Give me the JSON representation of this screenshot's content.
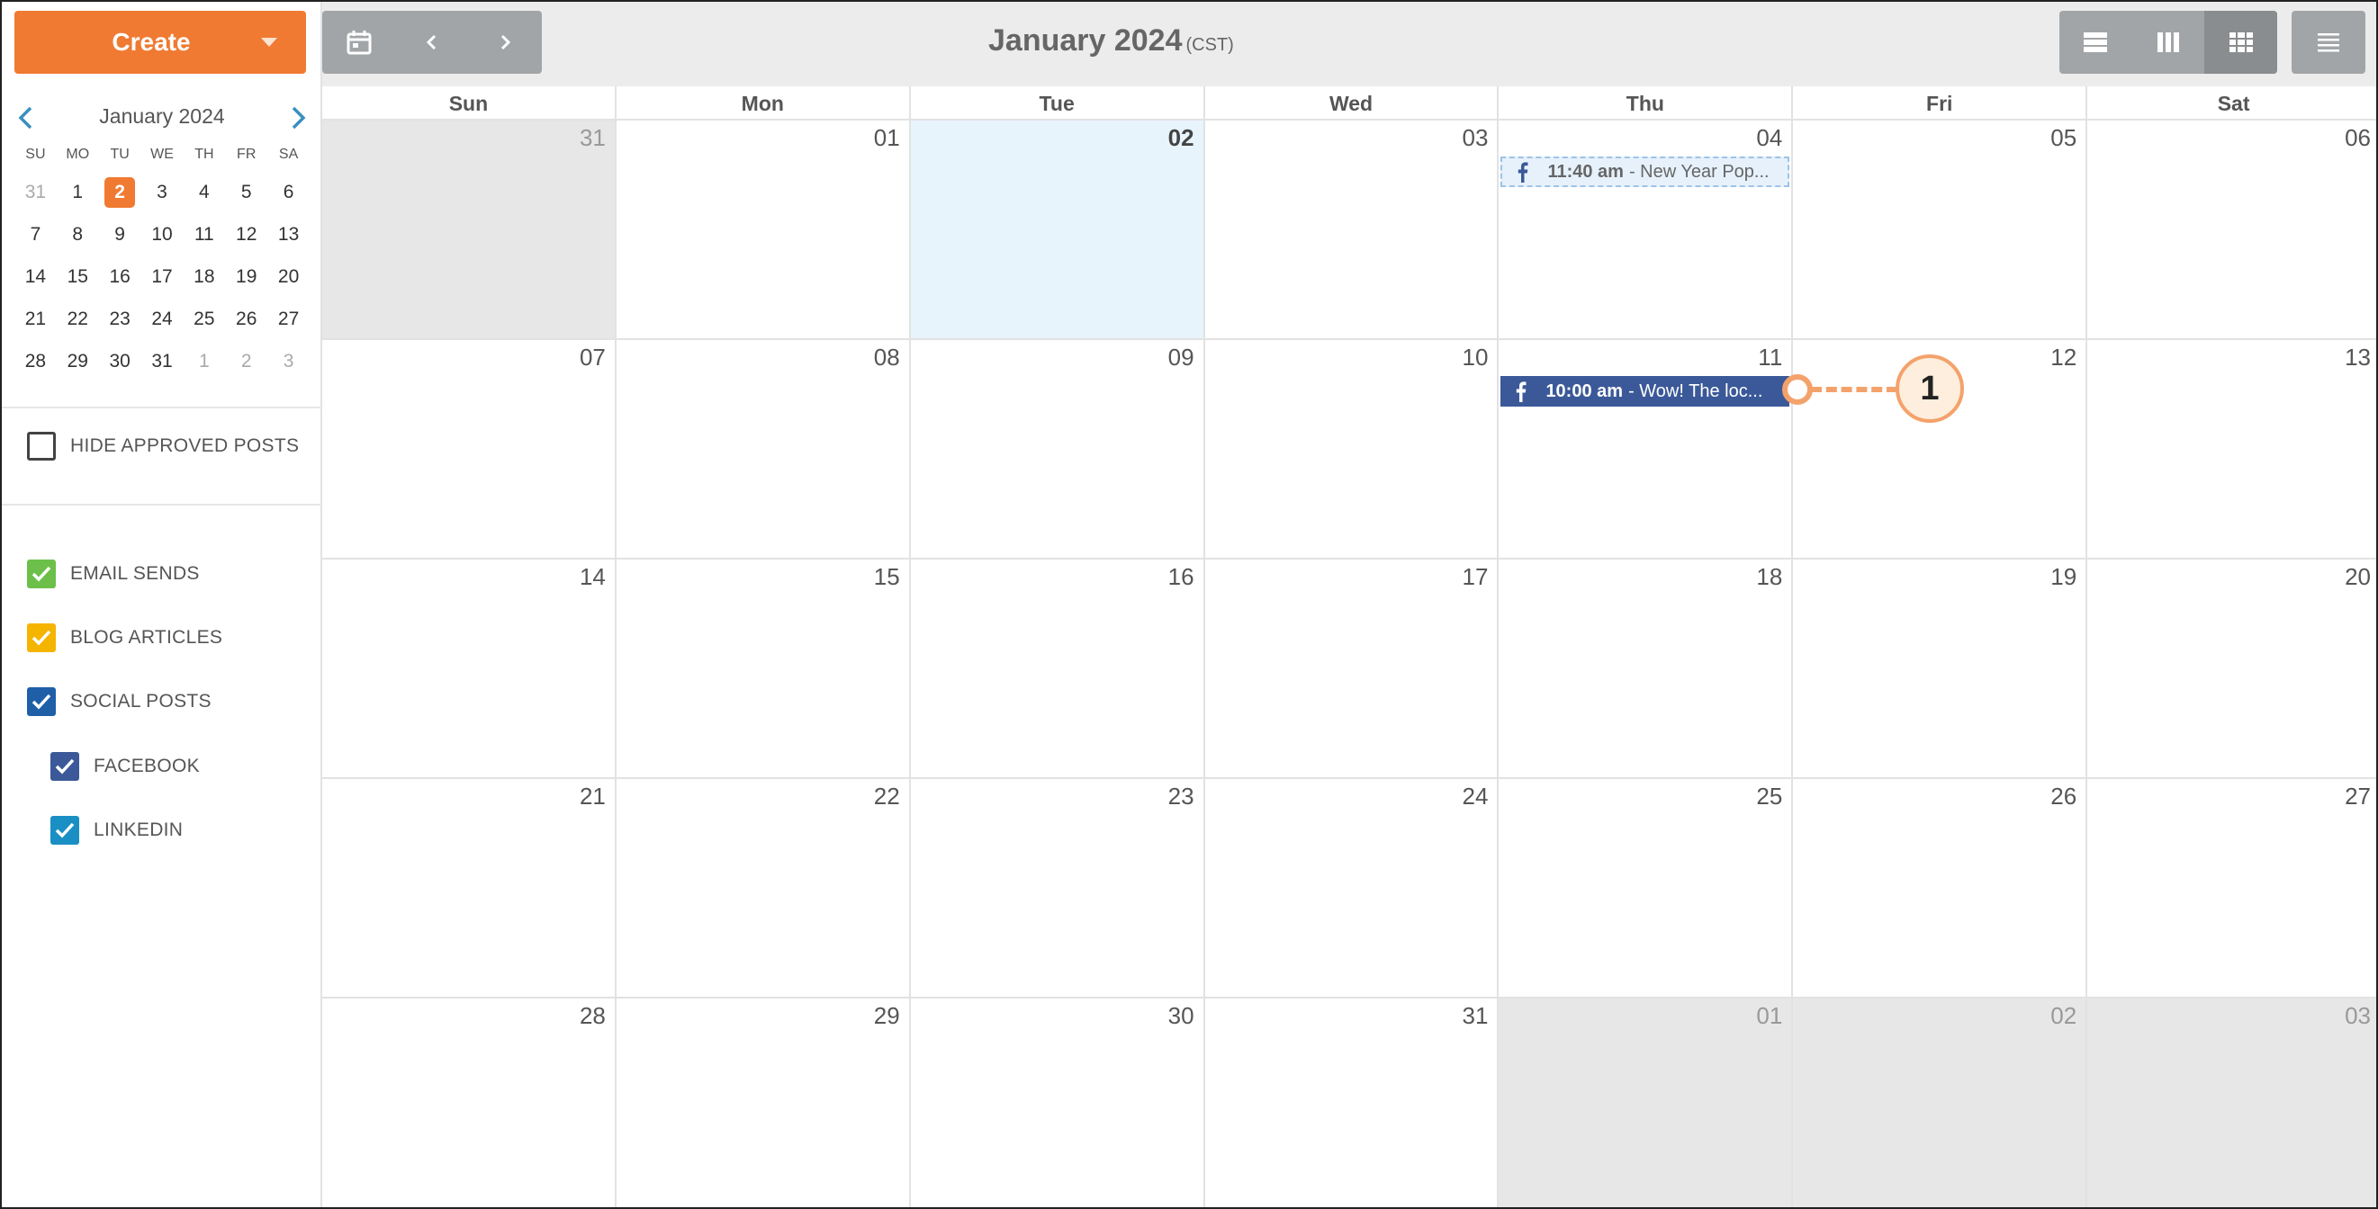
{
  "sidebar": {
    "create_label": "Create",
    "mini_calendar": {
      "title": "January 2024",
      "weekdays": [
        "SU",
        "MO",
        "TU",
        "WE",
        "TH",
        "FR",
        "SA"
      ],
      "days": [
        {
          "d": "31",
          "muted": true
        },
        {
          "d": "1"
        },
        {
          "d": "2",
          "today": true
        },
        {
          "d": "3"
        },
        {
          "d": "4"
        },
        {
          "d": "5"
        },
        {
          "d": "6"
        },
        {
          "d": "7"
        },
        {
          "d": "8"
        },
        {
          "d": "9"
        },
        {
          "d": "10"
        },
        {
          "d": "11"
        },
        {
          "d": "12"
        },
        {
          "d": "13"
        },
        {
          "d": "14"
        },
        {
          "d": "15"
        },
        {
          "d": "16"
        },
        {
          "d": "17"
        },
        {
          "d": "18"
        },
        {
          "d": "19"
        },
        {
          "d": "20"
        },
        {
          "d": "21"
        },
        {
          "d": "22"
        },
        {
          "d": "23"
        },
        {
          "d": "24"
        },
        {
          "d": "25"
        },
        {
          "d": "26"
        },
        {
          "d": "27"
        },
        {
          "d": "28"
        },
        {
          "d": "29"
        },
        {
          "d": "30"
        },
        {
          "d": "31"
        },
        {
          "d": "1",
          "muted": true
        },
        {
          "d": "2",
          "muted": true
        },
        {
          "d": "3",
          "muted": true
        }
      ]
    },
    "hide_approved_label": "HIDE APPROVED POSTS",
    "filters": {
      "email_sends": {
        "label": "EMAIL SENDS",
        "color": "#6cc04a"
      },
      "blog_articles": {
        "label": "BLOG ARTICLES",
        "color": "#f5b400"
      },
      "social_posts": {
        "label": "SOCIAL POSTS",
        "color": "#1f5fa8"
      },
      "facebook": {
        "label": "FACEBOOK",
        "color": "#3b5998"
      },
      "linkedin": {
        "label": "LINKEDIN",
        "color": "#1a8fc4"
      }
    }
  },
  "header": {
    "title": "January 2024",
    "timezone": "(CST)"
  },
  "calendar": {
    "weekdays": [
      "Sun",
      "Mon",
      "Tue",
      "Wed",
      "Thu",
      "Fri",
      "Sat"
    ],
    "weeks": [
      [
        {
          "d": "31",
          "other": true
        },
        {
          "d": "01"
        },
        {
          "d": "02",
          "today": true
        },
        {
          "d": "03"
        },
        {
          "d": "04",
          "event": "e1"
        },
        {
          "d": "05"
        },
        {
          "d": "06"
        }
      ],
      [
        {
          "d": "07"
        },
        {
          "d": "08"
        },
        {
          "d": "09"
        },
        {
          "d": "10"
        },
        {
          "d": "11",
          "event": "e2"
        },
        {
          "d": "12"
        },
        {
          "d": "13"
        }
      ],
      [
        {
          "d": "14"
        },
        {
          "d": "15"
        },
        {
          "d": "16"
        },
        {
          "d": "17"
        },
        {
          "d": "18"
        },
        {
          "d": "19"
        },
        {
          "d": "20"
        }
      ],
      [
        {
          "d": "21"
        },
        {
          "d": "22"
        },
        {
          "d": "23"
        },
        {
          "d": "24"
        },
        {
          "d": "25"
        },
        {
          "d": "26"
        },
        {
          "d": "27"
        }
      ],
      [
        {
          "d": "28"
        },
        {
          "d": "29"
        },
        {
          "d": "30"
        },
        {
          "d": "31"
        },
        {
          "d": "01",
          "other": true
        },
        {
          "d": "02",
          "other": true
        },
        {
          "d": "03",
          "other": true
        }
      ]
    ],
    "events": {
      "e1": {
        "time": "11:40 am",
        "text": "- New Year Pop...",
        "style": "light"
      },
      "e2": {
        "time": "10:00 am",
        "text": "- Wow! The loc...",
        "style": "dark"
      }
    }
  },
  "callout": {
    "label": "1"
  }
}
